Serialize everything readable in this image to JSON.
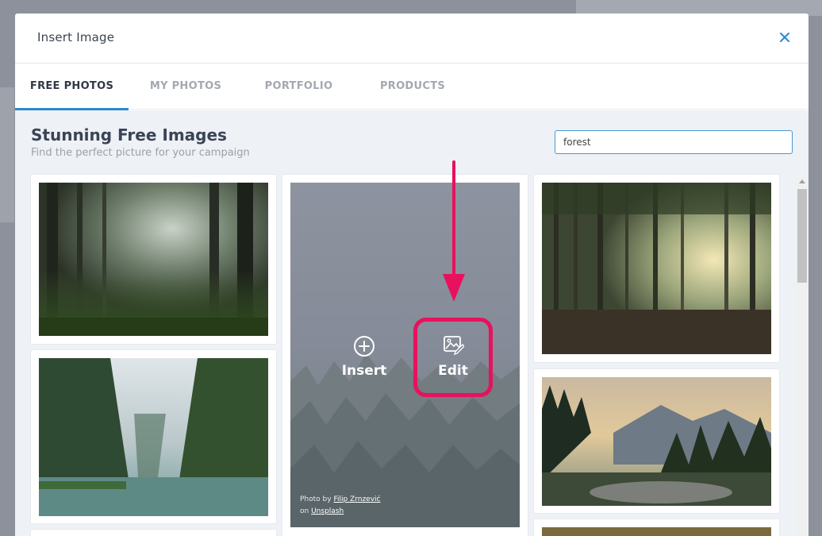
{
  "modal": {
    "title": "Insert Image"
  },
  "tabs": [
    {
      "label": "FREE PHOTOS",
      "active": true
    },
    {
      "label": "MY PHOTOS",
      "active": false
    },
    {
      "label": "PORTFOLIO",
      "active": false
    },
    {
      "label": "PRODUCTS",
      "active": false
    }
  ],
  "main": {
    "heading": "Stunning Free Images",
    "subheading": "Find the perfect picture for your campaign",
    "search_value": "forest"
  },
  "hover_card": {
    "insert_label": "Insert",
    "edit_label": "Edit",
    "credit_prefix": "Photo by",
    "credit_author": "Filip Zrnzević",
    "credit_on": "on",
    "credit_source": "Unsplash"
  },
  "colors": {
    "accent": "#2f89c9",
    "highlight": "#e8115d",
    "heading": "#3a4456"
  }
}
